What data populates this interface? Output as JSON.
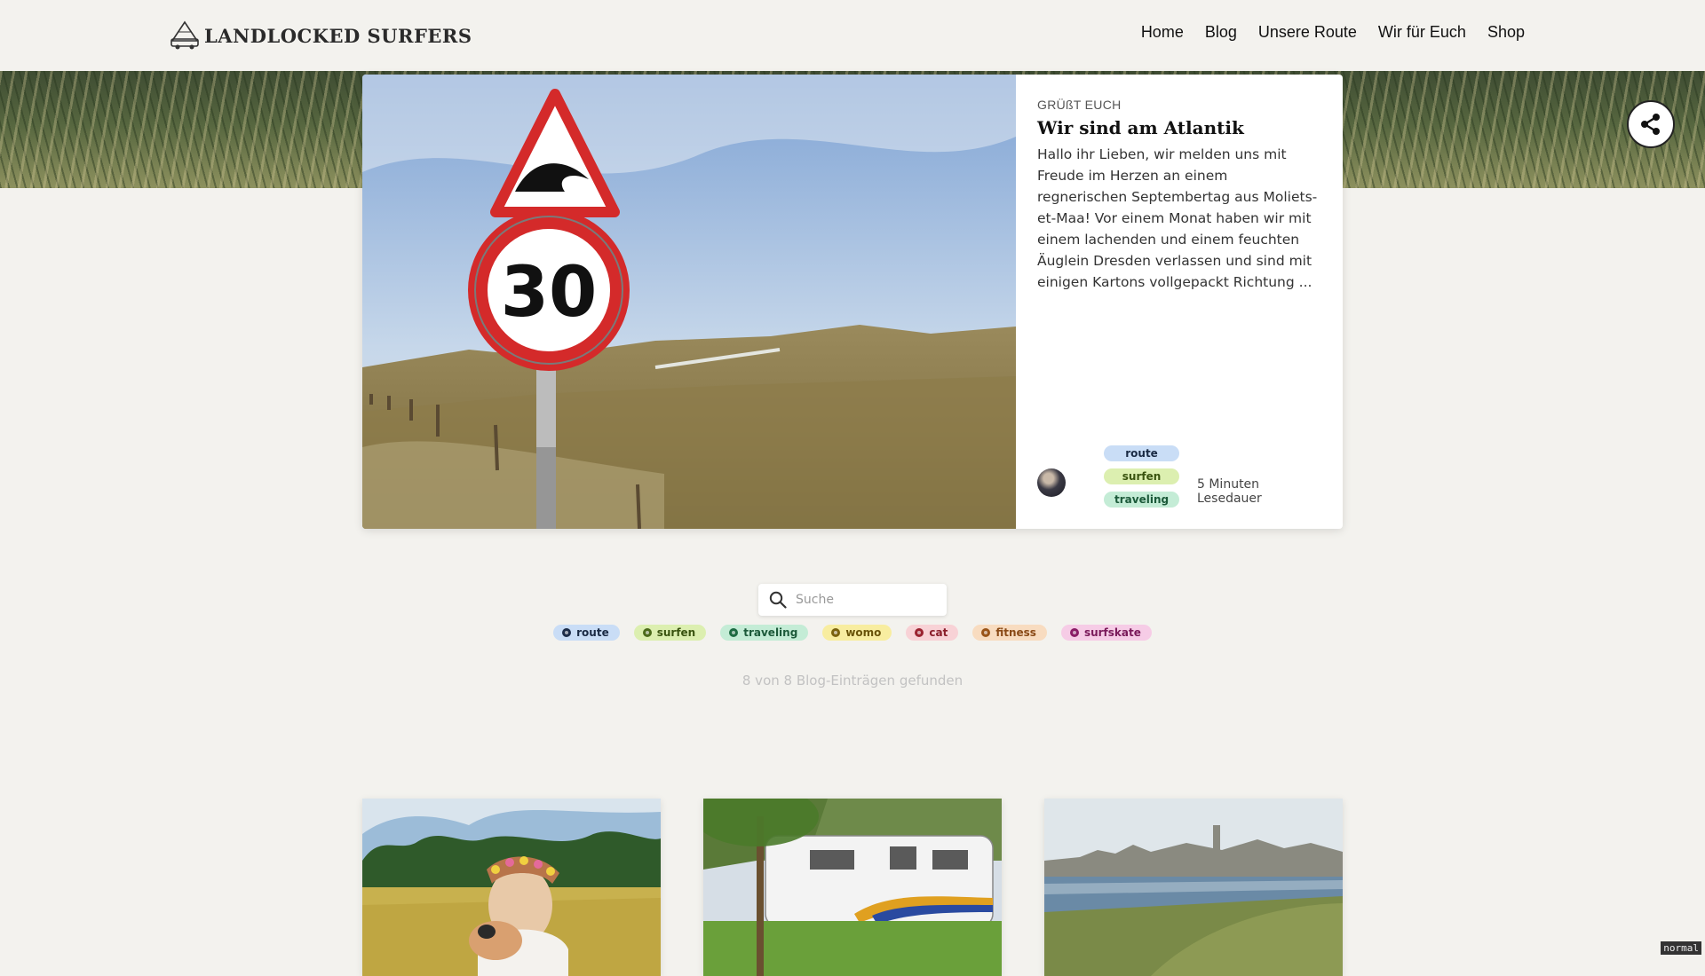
{
  "header": {
    "logo_text": "LANDLOCKED SURFERS",
    "nav": [
      "Home",
      "Blog",
      "Unsere Route",
      "Wir für Euch",
      "Shop"
    ]
  },
  "featured": {
    "kicker": "GRÜßT EUCH",
    "title": "Wir sind am Atlantik",
    "excerpt": "Hallo ihr Lieben, wir melden uns mit Freude im Herzen an einem regnerischen Septembertag aus Moliets-et-Maa! Vor einem Monat haben wir mit einem lachenden und einem feuchten Äuglein Dresden verlassen und sind mit einigen Kartons vollgepackt Richtung ...",
    "tags": [
      "route",
      "surfen",
      "traveling"
    ],
    "reading_time": "5 Minuten Lesedauer",
    "image_sign_number": "30"
  },
  "search": {
    "placeholder": "Suche",
    "value": ""
  },
  "filter_tags": [
    {
      "label": "route",
      "bg": "#c9ddf6",
      "fg": "#1a2a44",
      "dot": "#1c2c48"
    },
    {
      "label": "surfen",
      "bg": "#dcefb0",
      "fg": "#3a5410",
      "dot": "#4b6a1a"
    },
    {
      "label": "traveling",
      "bg": "#c4ecd6",
      "fg": "#1c5a3a",
      "dot": "#1d6b42"
    },
    {
      "label": "womo",
      "bg": "#f8eda0",
      "fg": "#6a5408",
      "dot": "#7a620e"
    },
    {
      "label": "cat",
      "bg": "#f8d2d6",
      "fg": "#8a1e2a",
      "dot": "#9b2230"
    },
    {
      "label": "fitness",
      "bg": "#f8dcc0",
      "fg": "#8a4a16",
      "dot": "#9a5418"
    },
    {
      "label": "surfskate",
      "bg": "#f6cce6",
      "fg": "#7a1a5a",
      "dot": "#8a1c66"
    }
  ],
  "found_text": "8 von 8 Blog-Einträgen gefunden",
  "status_badge": "normal"
}
